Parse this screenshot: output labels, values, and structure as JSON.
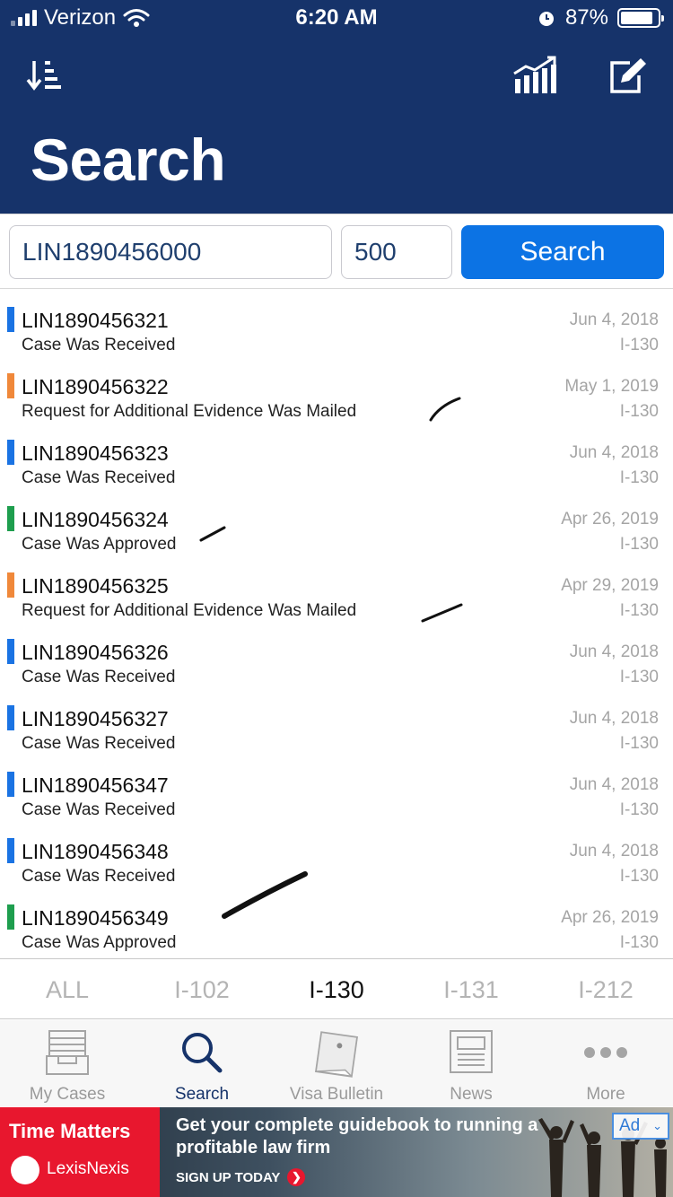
{
  "status_bar": {
    "carrier": "Verizon",
    "time": "6:20 AM",
    "battery": "87%",
    "battery_level": 0.87
  },
  "header": {
    "title": "Search",
    "left_icon": "sort-icon",
    "right_icons": [
      "chart-icon",
      "edit-icon"
    ],
    "background": "#16336a"
  },
  "search": {
    "receipt_value": "LIN1890456000",
    "count_value": "500",
    "button_label": "Search",
    "button_color": "#0c73e4"
  },
  "cases": [
    {
      "receipt": "LIN1890456321",
      "status": "Case Was Received",
      "date": "Jun 4, 2018",
      "form": "I-130",
      "color": "#1a73e3"
    },
    {
      "receipt": "LIN1890456322",
      "status": "Request for Additional Evidence Was Mailed",
      "date": "May 1, 2019",
      "form": "I-130",
      "color": "#f0883a"
    },
    {
      "receipt": "LIN1890456323",
      "status": "Case Was Received",
      "date": "Jun 4, 2018",
      "form": "I-130",
      "color": "#1a73e3"
    },
    {
      "receipt": "LIN1890456324",
      "status": "Case Was Approved",
      "date": "Apr 26, 2019",
      "form": "I-130",
      "color": "#1e9e4e"
    },
    {
      "receipt": "LIN1890456325",
      "status": "Request for Additional Evidence Was Mailed",
      "date": "Apr 29, 2019",
      "form": "I-130",
      "color": "#f0883a"
    },
    {
      "receipt": "LIN1890456326",
      "status": "Case Was Received",
      "date": "Jun 4, 2018",
      "form": "I-130",
      "color": "#1a73e3"
    },
    {
      "receipt": "LIN1890456327",
      "status": "Case Was Received",
      "date": "Jun 4, 2018",
      "form": "I-130",
      "color": "#1a73e3"
    },
    {
      "receipt": "LIN1890456347",
      "status": "Case Was Received",
      "date": "Jun 4, 2018",
      "form": "I-130",
      "color": "#1a73e3"
    },
    {
      "receipt": "LIN1890456348",
      "status": "Case Was Received",
      "date": "Jun 4, 2018",
      "form": "I-130",
      "color": "#1a73e3"
    },
    {
      "receipt": "LIN1890456349",
      "status": "Case Was Approved",
      "date": "Apr 26, 2019",
      "form": "I-130",
      "color": "#1e9e4e"
    }
  ],
  "form_filter": {
    "tabs": [
      "ALL",
      "I-102",
      "I-130",
      "I-131",
      "I-212"
    ],
    "active": "I-130"
  },
  "tabbar": {
    "items": [
      {
        "label": "My Cases",
        "icon": "inbox-tray-icon"
      },
      {
        "label": "Search",
        "icon": "search-icon"
      },
      {
        "label": "Visa Bulletin",
        "icon": "bulletin-note-icon"
      },
      {
        "label": "News",
        "icon": "newspaper-icon"
      },
      {
        "label": "More",
        "icon": "more-dots-icon"
      }
    ],
    "active": "Search"
  },
  "ad": {
    "brand_line1": "Time Matters",
    "brand_line2": "LexisNexis",
    "headline": "Get your complete guidebook to running a profitable law firm",
    "cta": "SIGN UP TODAY",
    "badge": "Ad"
  }
}
